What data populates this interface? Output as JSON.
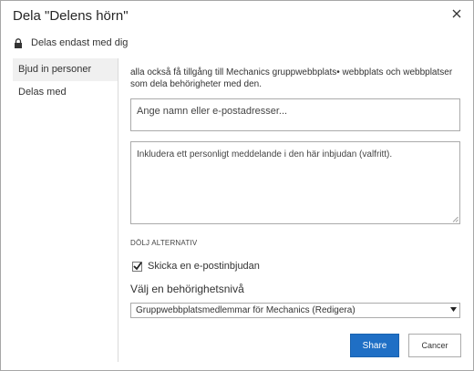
{
  "dialog": {
    "title": "Dela \"Delens hörn\"",
    "close_icon": "close-icon",
    "shared_status": "Delas endast med dig",
    "lock_icon": "lock-icon"
  },
  "nav": {
    "items": [
      {
        "label": "Bjud in personer",
        "active": true
      },
      {
        "label": "Delas med",
        "active": false
      }
    ]
  },
  "invite": {
    "description": "alla också få tillgång till Mechanics gruppwebbplats• webbplats och webbplatser som dela behörigheter med den.",
    "people_placeholder": "Ange namn eller e-postadresser...",
    "message_placeholder": "Inkludera ett personligt meddelande i den här inbjudan (valfritt).",
    "hide_options_label": "DÖLJ ALTERNATIV",
    "send_email_label": "Skicka en e-postinbjudan",
    "send_email_checked": true,
    "permission_label": "Välj en behörighetsnivå",
    "permission_selected": "Gruppwebbplatsmedlemmar för Mechanics (Redigera)"
  },
  "buttons": {
    "share": "Share",
    "cancel": "Cancer"
  },
  "colors": {
    "primary_button": "#1f6fc5",
    "nav_active_bg": "#f0f0f0",
    "border": "#ababab"
  }
}
